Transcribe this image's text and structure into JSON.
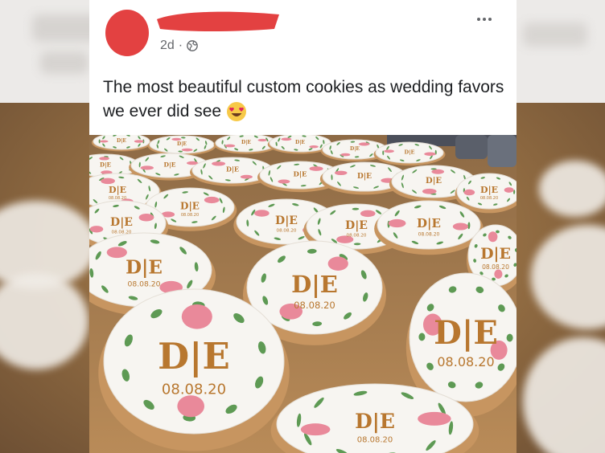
{
  "post": {
    "timestamp": "2d",
    "separator": "·",
    "privacy_icon": "globe-icon",
    "caption": "The most beautiful custom cookies as wedding favors we ever did see",
    "emoji": "heart-eyes-emoji",
    "more_icon": "more-options-icon",
    "redaction_color": "#e34141"
  },
  "photo": {
    "description_icon": "cookie-photo",
    "cookie_monogram": "D|E",
    "cookie_date": "08.08.20",
    "colors": {
      "frosting": "#f7f5f1",
      "biscuit": "#c79560",
      "gold": "#b8772f",
      "flower": "#e9899a",
      "leaf": "#5e9a54",
      "wood": "#a27749"
    }
  }
}
